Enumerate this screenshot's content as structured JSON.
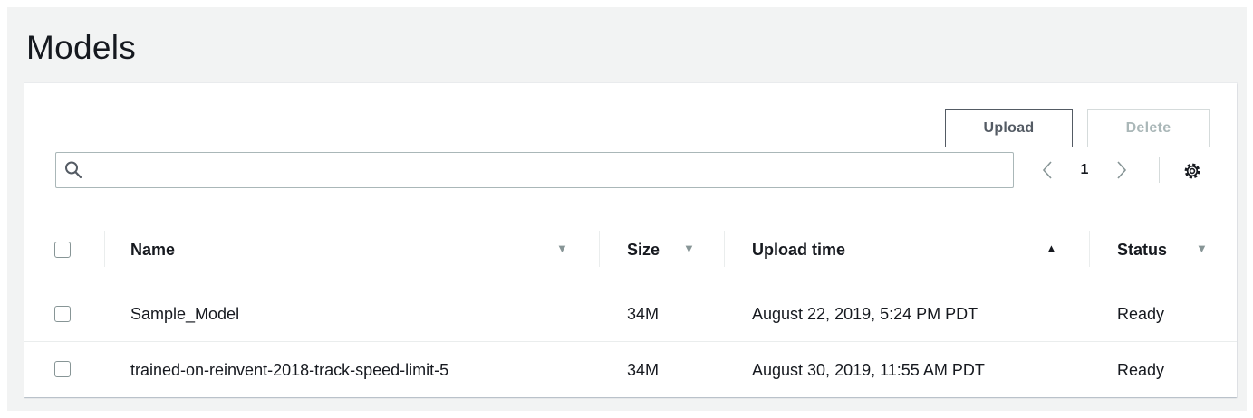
{
  "page": {
    "title": "Models"
  },
  "toolbar": {
    "upload_label": "Upload",
    "delete_label": "Delete"
  },
  "search": {
    "placeholder": "",
    "value": ""
  },
  "pagination": {
    "current_page": "1"
  },
  "table": {
    "columns": [
      {
        "label": "Name",
        "sort": "desc-inactive"
      },
      {
        "label": "Size",
        "sort": "desc-inactive"
      },
      {
        "label": "Upload time",
        "sort": "asc-active"
      },
      {
        "label": "Status",
        "sort": "desc-inactive"
      }
    ],
    "rows": [
      {
        "name": "Sample_Model",
        "size": "34M",
        "upload_time": "August 22, 2019, 5:24 PM PDT",
        "status": "Ready"
      },
      {
        "name": "trained-on-reinvent-2018-track-speed-limit-5",
        "size": "34M",
        "upload_time": "August 30, 2019, 11:55 AM PDT",
        "status": "Ready"
      }
    ]
  },
  "icons": {
    "search": "search-icon",
    "prev": "chevron-left-icon",
    "next": "chevron-right-icon",
    "settings": "gear-icon",
    "sort_down": "caret-down-icon",
    "sort_up": "caret-up-icon"
  },
  "colors": {
    "page_background": "#f2f3f3",
    "panel_background": "#ffffff",
    "text": "#16191f",
    "muted": "#879596",
    "border": "#aab7b8",
    "disabled": "#aab7b8"
  }
}
